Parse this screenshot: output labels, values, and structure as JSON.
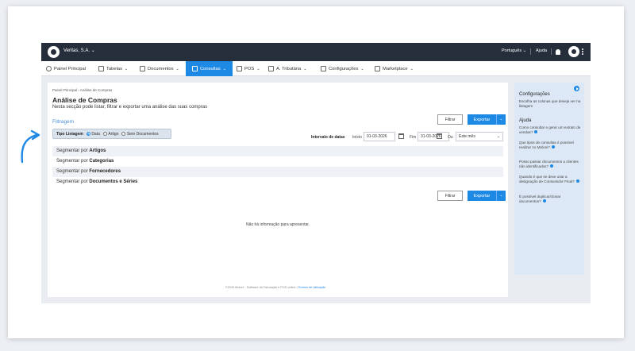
{
  "topbar": {
    "company": "Veritas, S.A. ⌄",
    "language": "Português ⌄",
    "help": "Ajuda"
  },
  "nav": {
    "items": [
      {
        "label": "Painel Principal"
      },
      {
        "label": "Tabelas"
      },
      {
        "label": "Documentos"
      },
      {
        "label": "Consultas"
      },
      {
        "label": "POS"
      },
      {
        "label": "A. Tributária"
      },
      {
        "label": "Configurações"
      },
      {
        "label": "Marketplace"
      }
    ]
  },
  "main": {
    "breadcrumb": "Painel Principal  ›  Análise de Compras",
    "title": "Análise de Compras",
    "subtitle": "Nesta secção pode listar, filtrar e exportar uma análise das suas compras",
    "filtragem": "Filtragem",
    "filter_label": "Filtrar",
    "export_label": "Exportar",
    "tipo_listagem": {
      "label": "Tipo Listagem",
      "options": [
        "Data",
        "Artigo",
        "Sem Documentos"
      ],
      "selected": "Data"
    },
    "intervalo": {
      "label": "Intervalo de datas",
      "inicio_label": "Início",
      "inicio_value": "01-03-2026",
      "fim_label": "Fim",
      "fim_value": "31-03-2026",
      "ou_label": "Ou",
      "period_value": "Este mês"
    },
    "segments": [
      {
        "prefix": "Segmentar por",
        "name": "Artigos"
      },
      {
        "prefix": "Segmentar por",
        "name": "Categorias"
      },
      {
        "prefix": "Segmentar por",
        "name": "Fornecedores"
      },
      {
        "prefix": "Segmentar por",
        "name": "Documentos e Séries"
      }
    ],
    "empty_message": "Não há informação para apresentar."
  },
  "footer": {
    "text": "©2026 Moloni - Software de Faturação e POS online |",
    "link": "Termos de utilização"
  },
  "sidebar": {
    "config_title": "Configurações",
    "config_text": "Escolha as colunas que deseja ver na listagem",
    "help_title": "Ajuda",
    "help_items": [
      "Como consultar e gerar um extrato de vendas?",
      "Que tipos de consultas é possível realizar no Moloni?",
      "Posso passar documentos a clientes não identificados?",
      "Quando é que se deve usar a designação de Consumidor Final?",
      "É possível duplicar/clonar documentos?"
    ]
  },
  "colors": {
    "accent": "#1e88e5",
    "topbar": "#262e3b",
    "sidebar": "#dce8f6"
  }
}
